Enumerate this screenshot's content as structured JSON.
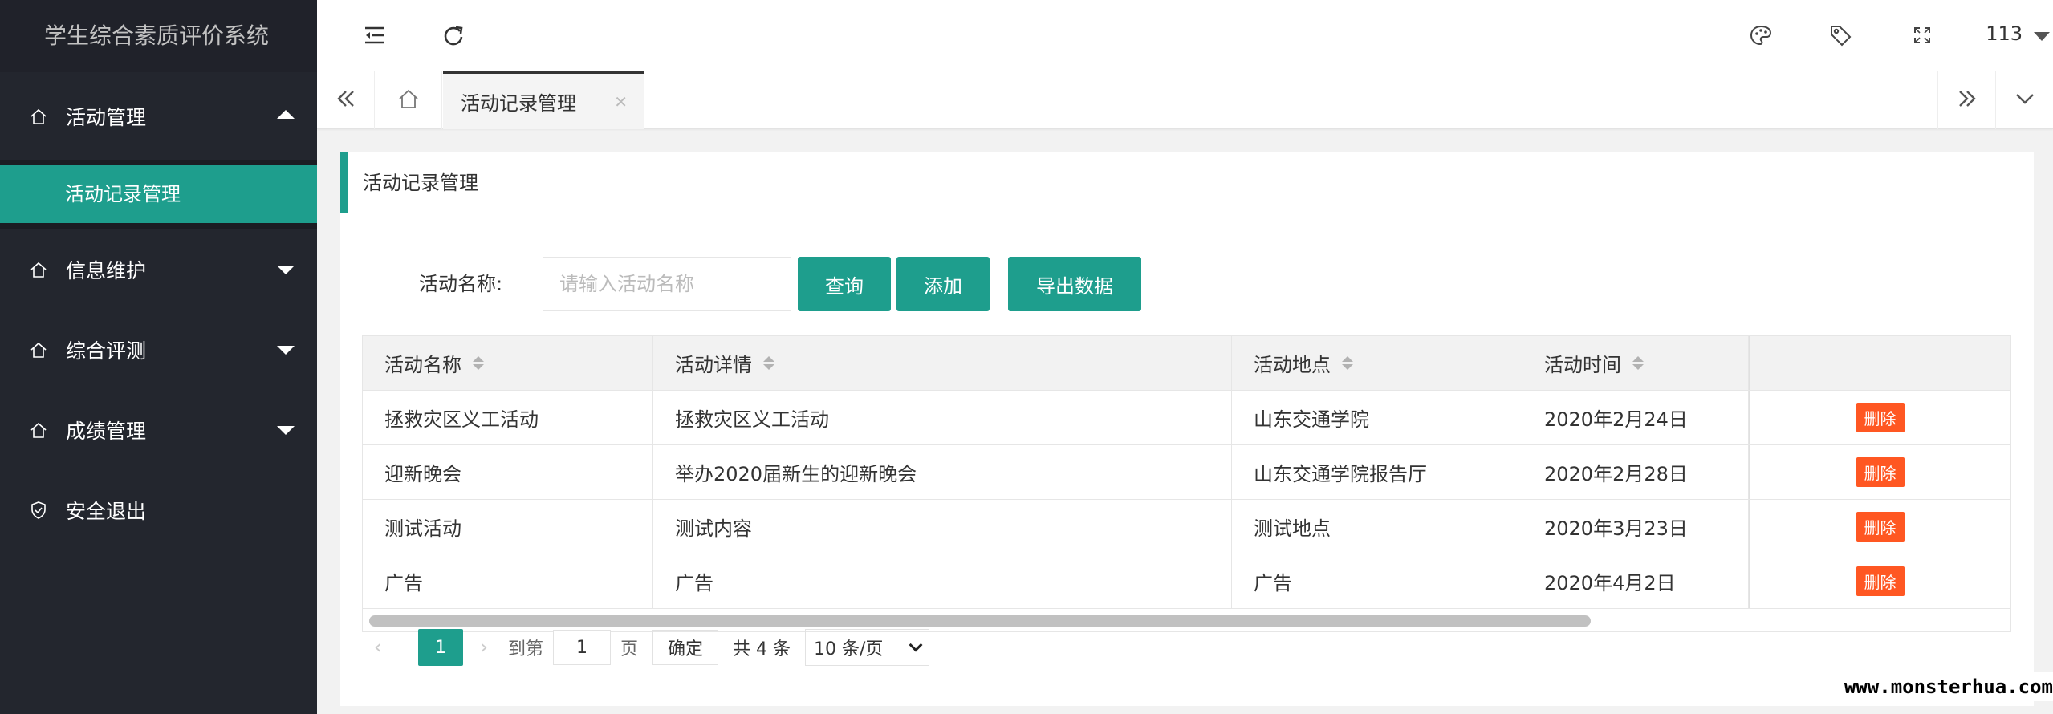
{
  "app": {
    "title": "学生综合素质评价系统"
  },
  "sidebar": {
    "menus": [
      {
        "label": "活动管理",
        "icon": "home-icon",
        "expanded": true,
        "children": [
          {
            "label": "活动记录管理",
            "active": true
          }
        ]
      },
      {
        "label": "信息维护",
        "icon": "home-icon",
        "expanded": false
      },
      {
        "label": "综合评测",
        "icon": "home-icon",
        "expanded": false
      },
      {
        "label": "成绩管理",
        "icon": "home-icon",
        "expanded": false
      },
      {
        "label": "安全退出",
        "icon": "shield-check-icon"
      }
    ]
  },
  "header": {
    "icons": [
      "menu-fold-icon",
      "refresh-icon",
      "palette-icon",
      "tag-icon",
      "fullscreen-icon"
    ],
    "user": "113"
  },
  "tabs": {
    "active_label": "活动记录管理",
    "icons": [
      "double-left-icon",
      "home-icon",
      "double-right-icon",
      "chevron-down-icon"
    ]
  },
  "main": {
    "title": "活动记录管理",
    "search": {
      "label": "活动名称:",
      "placeholder": "请输入活动名称",
      "query_btn": "查询",
      "add_btn": "添加",
      "export_btn": "导出数据"
    },
    "table": {
      "columns": [
        "活动名称",
        "活动详情",
        "活动地点",
        "活动时间",
        ""
      ],
      "rows": [
        {
          "name": "拯救灾区义工活动",
          "detail": "拯救灾区义工活动",
          "place": "山东交通学院",
          "time": "2020年2月24日",
          "action": "删除"
        },
        {
          "name": "迎新晚会",
          "detail": "举办2020届新生的迎新晚会",
          "place": "山东交通学院报告厅",
          "time": "2020年2月28日",
          "action": "删除"
        },
        {
          "name": "测试活动",
          "detail": "测试内容",
          "place": "测试地点",
          "time": "2020年3月23日",
          "action": "删除"
        },
        {
          "name": "广告",
          "detail": "广告",
          "place": "广告",
          "time": "2020年4月2日",
          "action": "删除"
        }
      ]
    },
    "pager": {
      "current": "1",
      "goto_label": "到第",
      "goto_value": "1",
      "page_unit": "页",
      "ok": "确定",
      "total": "共 4 条",
      "page_size": "10 条/页"
    }
  },
  "watermark": "www.monsterhua.com",
  "colors": {
    "accent": "#1e9e8d",
    "sidebar": "#23262e",
    "danger": "#ff5722"
  }
}
